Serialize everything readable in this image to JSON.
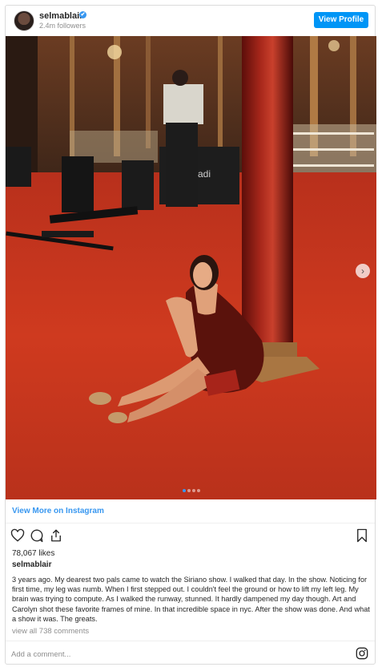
{
  "header": {
    "username": "selmablair",
    "verified_mark": "✔",
    "followers": "2.4m followers",
    "view_profile_label": "View Profile"
  },
  "post": {
    "view_more_label": "View More on Instagram",
    "likes": "78,067 likes",
    "caption_username": "selmablair",
    "caption": "3 years ago. My dearest two pals came to watch the Siriano show. I walked that day. In the show. Noticing for first time, my leg was numb. When I first stepped out. I couldn't feel the ground or how to lift my left leg. My brain was trying to compute. As I walked the runway, stunned. It hardly dampened my day though. Art and Carolyn shot these favorite frames of mine. In that incredible space in nyc. After the show was done. And what a show it was. The greats.",
    "view_comments": "view all 738 comments",
    "comment_placeholder": "Add a comment...",
    "carousel_total": 4,
    "carousel_active": 1,
    "next_glyph": "›",
    "equipment_text": "adi"
  },
  "icons": [
    "heart-icon",
    "comment-icon",
    "share-icon",
    "bookmark-icon",
    "instagram-icon",
    "chevron-right-icon",
    "verified-icon"
  ],
  "colors": {
    "accent": "#0095f6",
    "link": "#3897f0",
    "carpet": "#c8341c",
    "pillar": "#8e1a12",
    "muted": "#8e8e8e"
  }
}
